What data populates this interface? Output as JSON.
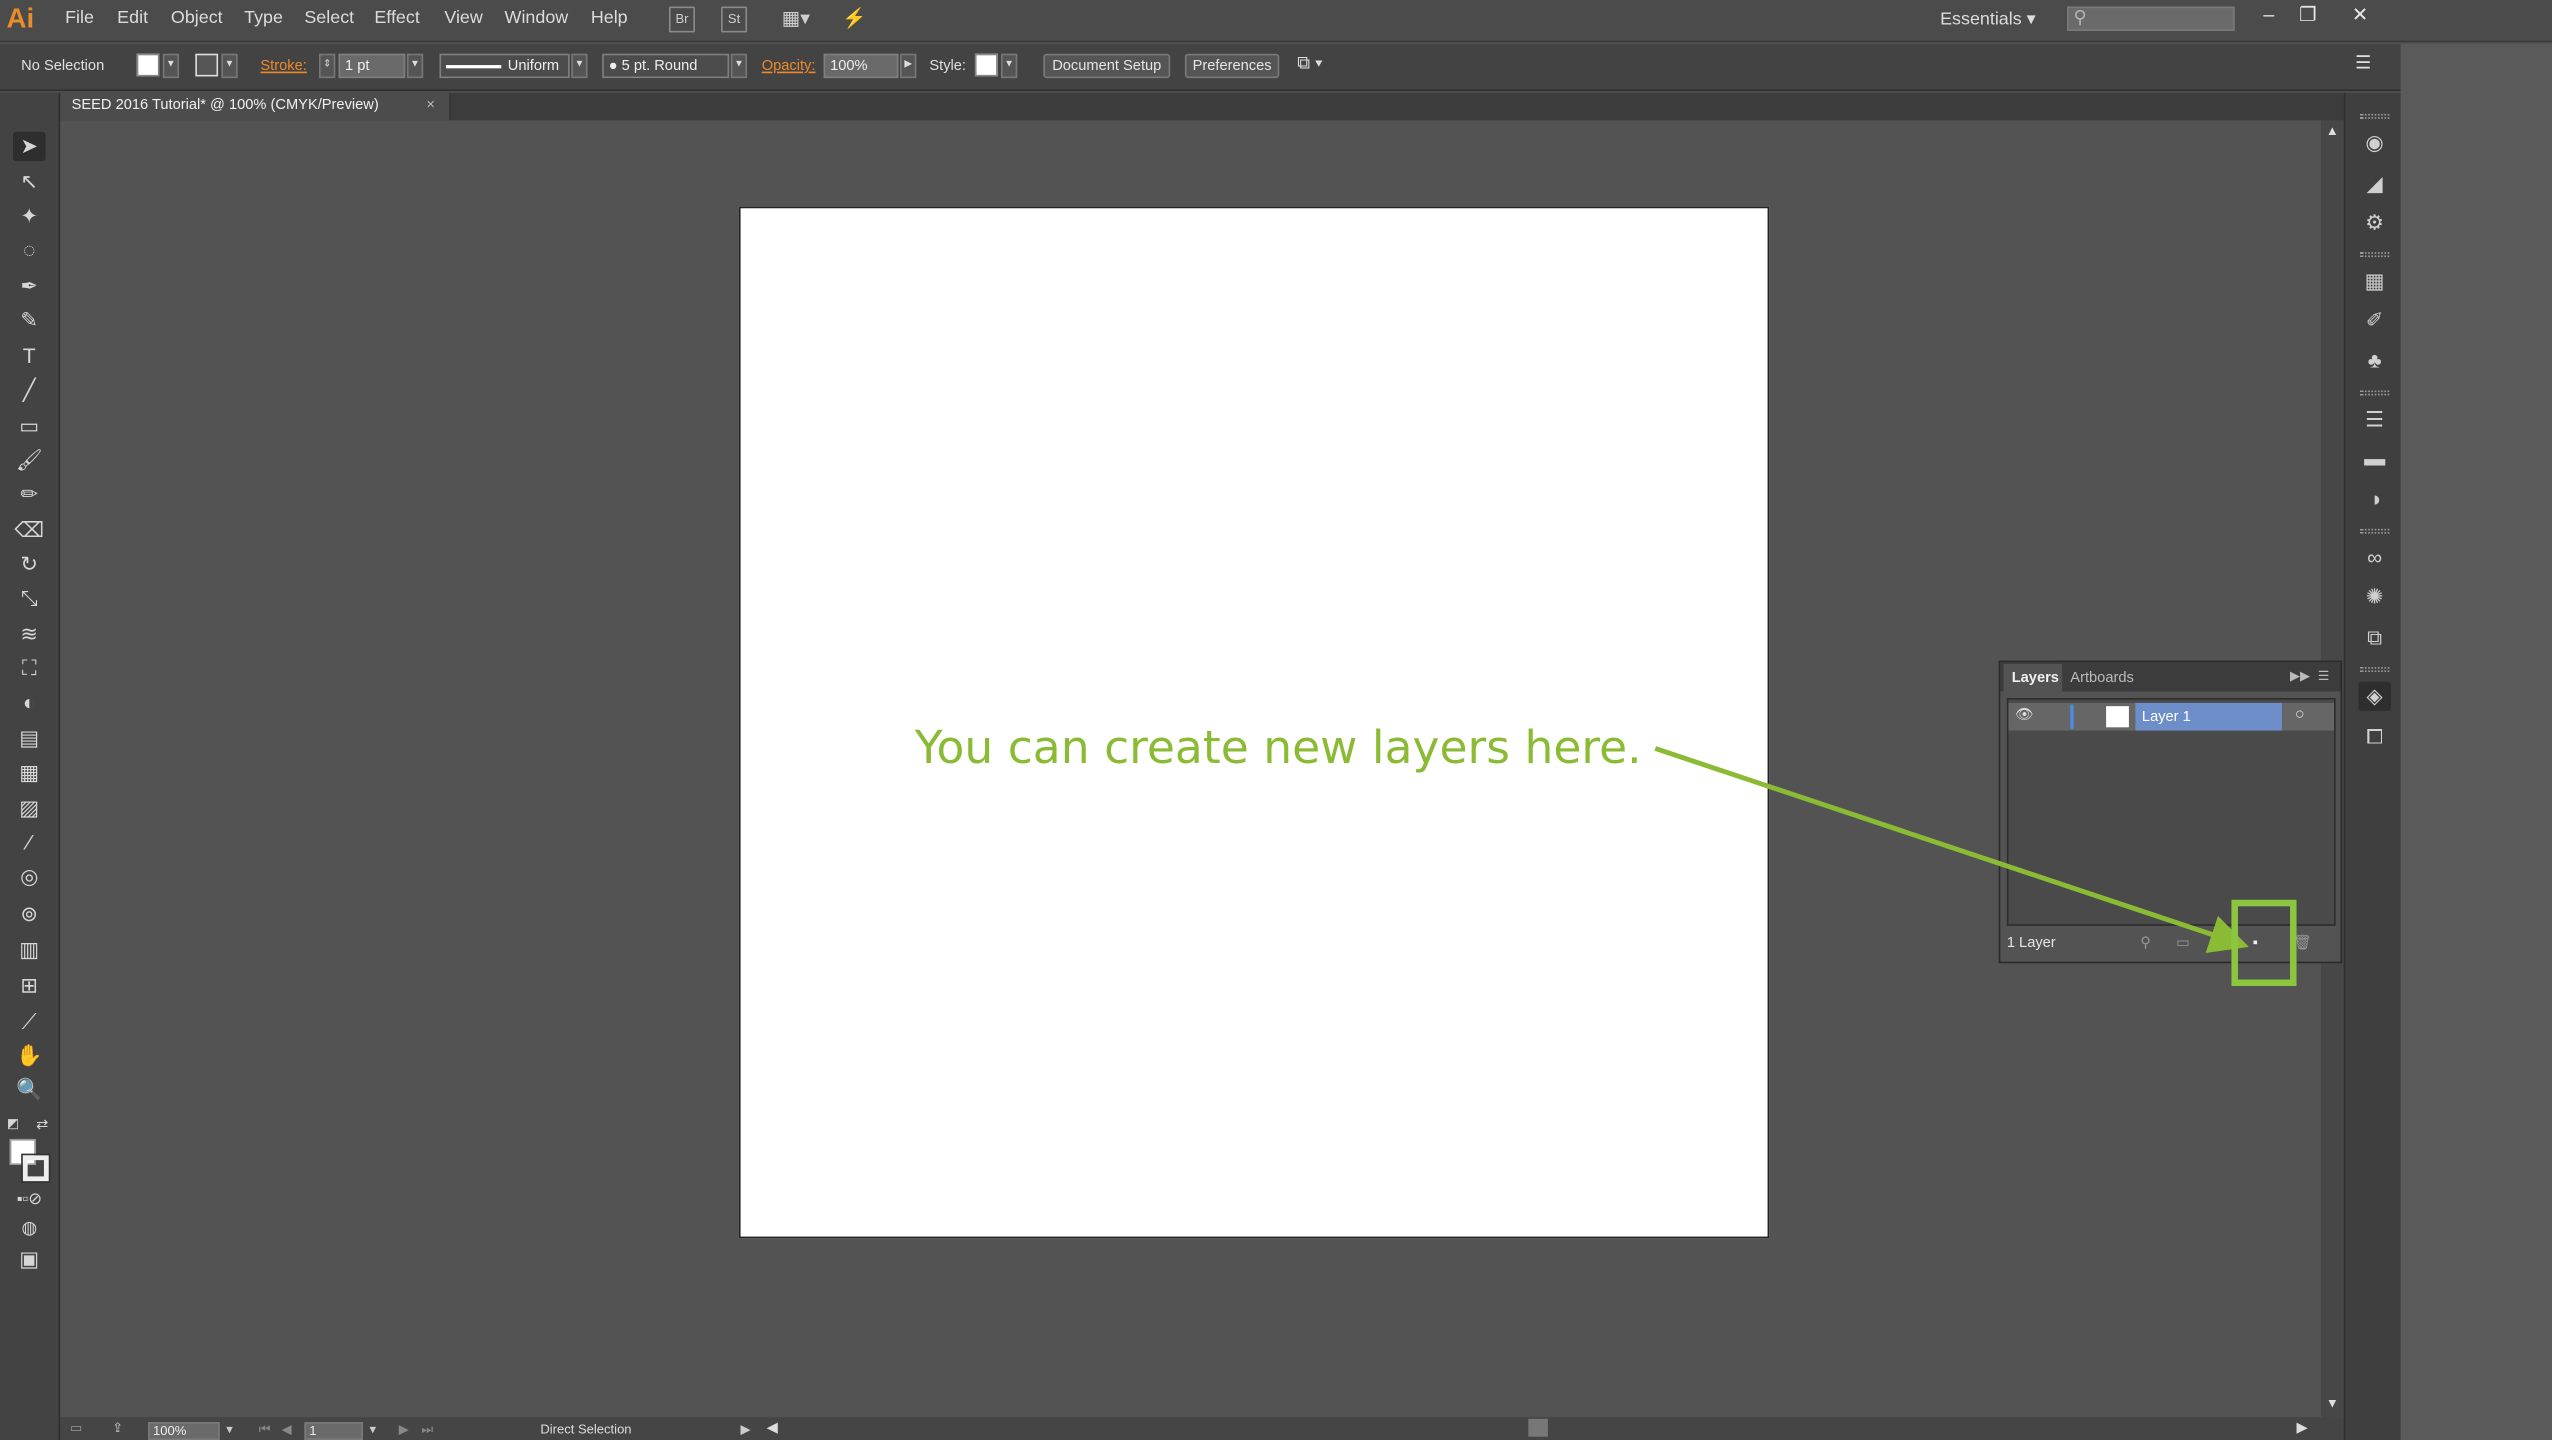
{
  "app": {
    "logo": "Ai"
  },
  "menu": [
    "File",
    "Edit",
    "Object",
    "Type",
    "Select",
    "Effect",
    "View",
    "Window",
    "Help"
  ],
  "menubar_buttons": {
    "bridge": "Br",
    "stock": "St"
  },
  "workspace": {
    "label": "Essentials"
  },
  "control_bar": {
    "selection": "No Selection",
    "stroke_label": "Stroke:",
    "stroke_weight": "1 pt",
    "stroke_profile": "Uniform",
    "brush": "5 pt. Round",
    "opacity_label": "Opacity:",
    "opacity_value": "100%",
    "style_label": "Style:",
    "document_setup": "Document Setup",
    "preferences": "Preferences"
  },
  "document_tab": {
    "title": "SEED 2016 Tutorial* @ 100% (CMYK/Preview)",
    "close": "×"
  },
  "layers_panel": {
    "tabs": [
      "Layers",
      "Artboards"
    ],
    "layers": [
      {
        "name": "Layer 1",
        "visible": true
      }
    ],
    "count_label": "1 Layer"
  },
  "annotation": {
    "text": "You can create new layers here.",
    "color": "#8bbb34"
  },
  "status_bar": {
    "zoom": "100%",
    "artboard_number": "1",
    "tool": "Direct Selection"
  },
  "window_controls": {
    "minimize": "–",
    "restore": "❐",
    "close": "✕"
  }
}
